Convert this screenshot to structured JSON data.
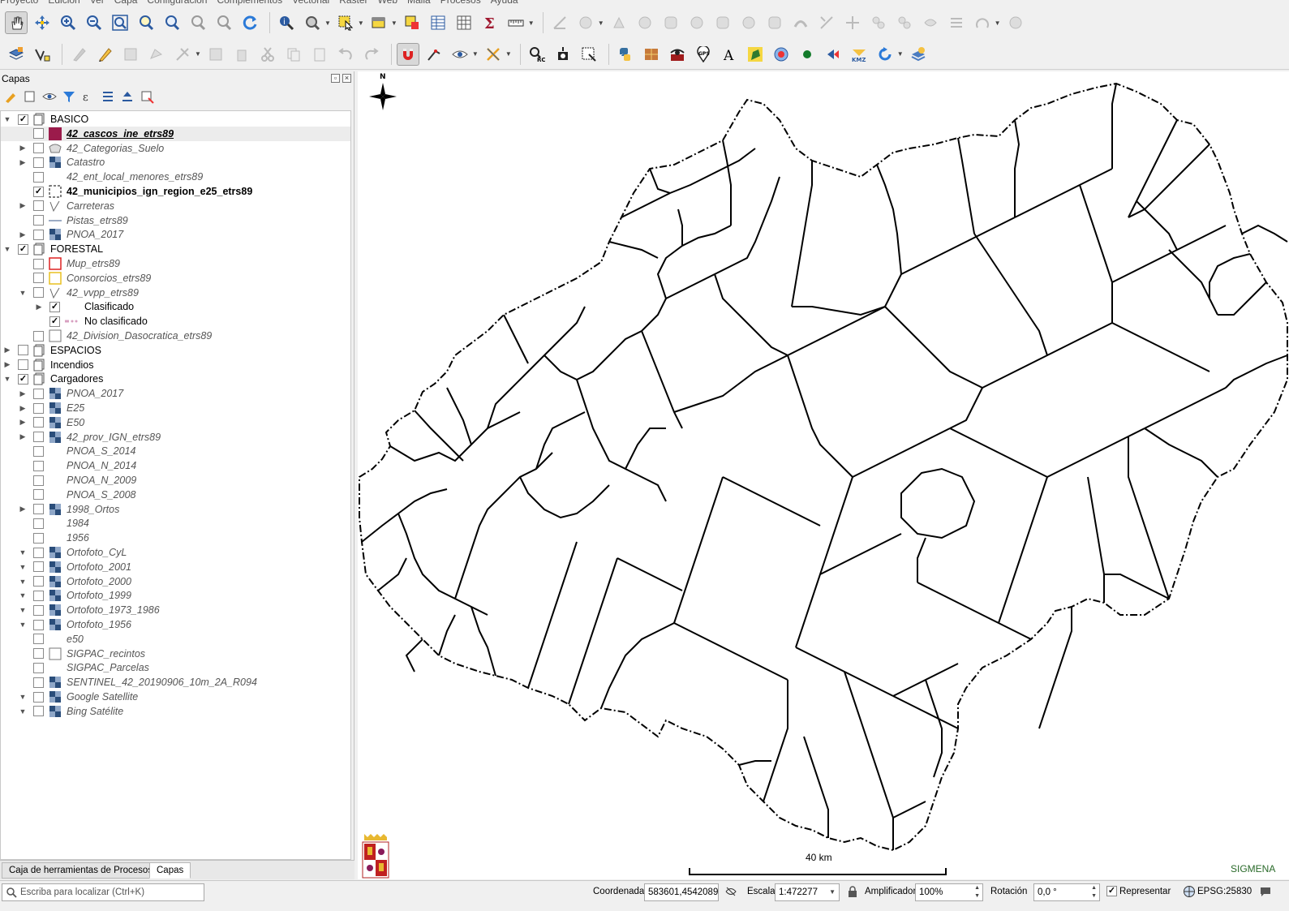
{
  "menu": [
    "Proyecto",
    "Edición",
    "Ver",
    "Capa",
    "Configuración",
    "Complementos",
    "Vectorial",
    "Ráster",
    "Web",
    "Malla",
    "Procesos",
    "Ayuda"
  ],
  "layers_panel": {
    "title": "Capas",
    "items": [
      {
        "name": "BASICO",
        "level": 0,
        "expander": "open",
        "checked": true,
        "icon": "group-icon",
        "style": "normal"
      },
      {
        "name": "42_cascos_ine_etrs89",
        "level": 1,
        "expander": "",
        "checked": false,
        "icon": "fill-swatch-icon",
        "swatch": "#9b1b4b",
        "style": "italic-bold-underline",
        "selected": true
      },
      {
        "name": "42_Categorias_Suelo",
        "level": 1,
        "expander": "closed",
        "checked": false,
        "icon": "polygon-layer-icon",
        "style": "italic"
      },
      {
        "name": "Catastro",
        "level": 1,
        "expander": "closed",
        "checked": false,
        "icon": "raster-icon",
        "style": "italic"
      },
      {
        "name": "42_ent_local_menores_etrs89",
        "level": 1,
        "expander": "",
        "checked": false,
        "icon": "",
        "style": "italic"
      },
      {
        "name": "42_municipios_ign_region_e25_etrs89",
        "level": 1,
        "expander": "",
        "checked": true,
        "icon": "dashed-outline-icon",
        "style": "bold"
      },
      {
        "name": "Carreteras",
        "level": 1,
        "expander": "closed",
        "checked": false,
        "icon": "line-rules-icon",
        "style": "italic"
      },
      {
        "name": "Pistas_etrs89",
        "level": 1,
        "expander": "",
        "checked": false,
        "icon": "line-swatch-icon",
        "style": "italic"
      },
      {
        "name": "PNOA_2017",
        "level": 1,
        "expander": "closed",
        "checked": false,
        "icon": "raster-icon",
        "style": "italic"
      },
      {
        "name": "FORESTAL",
        "level": 0,
        "expander": "open",
        "checked": true,
        "icon": "group-icon",
        "style": "normal"
      },
      {
        "name": "Mup_etrs89",
        "level": 1,
        "expander": "",
        "checked": false,
        "icon": "red-outline-icon",
        "style": "italic"
      },
      {
        "name": "Consorcios_etrs89",
        "level": 1,
        "expander": "",
        "checked": false,
        "icon": "yellow-outline-icon",
        "style": "italic"
      },
      {
        "name": "42_vvpp_etrs89",
        "level": 1,
        "expander": "open",
        "checked": false,
        "icon": "line-rules-icon",
        "style": "italic"
      },
      {
        "name": "Clasificado",
        "level": 2,
        "expander": "closed",
        "checked": true,
        "icon": "",
        "style": "normal"
      },
      {
        "name": "No clasificado",
        "level": 2,
        "expander": "",
        "checked": true,
        "icon": "pink-dash-icon",
        "style": "normal"
      },
      {
        "name": "42_Division_Dasocratica_etrs89",
        "level": 1,
        "expander": "",
        "checked": false,
        "icon": "gray-outline-icon",
        "style": "italic"
      },
      {
        "name": "ESPACIOS",
        "level": 0,
        "expander": "closed",
        "checked": false,
        "icon": "group-icon",
        "style": "normal"
      },
      {
        "name": "Incendios",
        "level": 0,
        "expander": "closed",
        "checked": false,
        "icon": "group-icon",
        "style": "normal"
      },
      {
        "name": "Cargadores",
        "level": 0,
        "expander": "open",
        "checked": true,
        "icon": "group-icon",
        "style": "normal"
      },
      {
        "name": "PNOA_2017",
        "level": 1,
        "expander": "closed",
        "checked": false,
        "icon": "raster-icon",
        "style": "italic"
      },
      {
        "name": "E25",
        "level": 1,
        "expander": "closed",
        "checked": false,
        "icon": "raster-icon",
        "style": "italic"
      },
      {
        "name": "E50",
        "level": 1,
        "expander": "closed",
        "checked": false,
        "icon": "raster-icon",
        "style": "italic"
      },
      {
        "name": "42_prov_IGN_etrs89",
        "level": 1,
        "expander": "closed",
        "checked": false,
        "icon": "raster-icon",
        "style": "italic"
      },
      {
        "name": "PNOA_S_2014",
        "level": 1,
        "expander": "",
        "checked": false,
        "icon": "",
        "style": "italic"
      },
      {
        "name": "PNOA_N_2014",
        "level": 1,
        "expander": "",
        "checked": false,
        "icon": "",
        "style": "italic"
      },
      {
        "name": "PNOA_N_2009",
        "level": 1,
        "expander": "",
        "checked": false,
        "icon": "",
        "style": "italic"
      },
      {
        "name": "PNOA_S_2008",
        "level": 1,
        "expander": "",
        "checked": false,
        "icon": "",
        "style": "italic"
      },
      {
        "name": "1998_Ortos",
        "level": 1,
        "expander": "closed",
        "checked": false,
        "icon": "raster-icon",
        "style": "italic"
      },
      {
        "name": "1984",
        "level": 1,
        "expander": "",
        "checked": false,
        "icon": "",
        "style": "italic"
      },
      {
        "name": "1956",
        "level": 1,
        "expander": "",
        "checked": false,
        "icon": "",
        "style": "italic"
      },
      {
        "name": "Ortofoto_CyL",
        "level": 1,
        "expander": "open",
        "checked": false,
        "icon": "raster-icon",
        "style": "italic"
      },
      {
        "name": "Ortofoto_2001",
        "level": 1,
        "expander": "open",
        "checked": false,
        "icon": "raster-icon",
        "style": "italic"
      },
      {
        "name": "Ortofoto_2000",
        "level": 1,
        "expander": "open",
        "checked": false,
        "icon": "raster-icon",
        "style": "italic"
      },
      {
        "name": "Ortofoto_1999",
        "level": 1,
        "expander": "open",
        "checked": false,
        "icon": "raster-icon",
        "style": "italic"
      },
      {
        "name": "Ortofoto_1973_1986",
        "level": 1,
        "expander": "open",
        "checked": false,
        "icon": "raster-icon",
        "style": "italic"
      },
      {
        "name": "Ortofoto_1956",
        "level": 1,
        "expander": "open",
        "checked": false,
        "icon": "raster-icon",
        "style": "italic"
      },
      {
        "name": "e50",
        "level": 1,
        "expander": "",
        "checked": false,
        "icon": "",
        "style": "italic"
      },
      {
        "name": "SIGPAC_recintos",
        "level": 1,
        "expander": "",
        "checked": false,
        "icon": "gray-outline-icon",
        "style": "italic"
      },
      {
        "name": "SIGPAC_Parcelas",
        "level": 1,
        "expander": "",
        "checked": false,
        "icon": "",
        "style": "italic"
      },
      {
        "name": "SENTINEL_42_20190906_10m_2A_R094",
        "level": 1,
        "expander": "",
        "checked": false,
        "icon": "raster-icon",
        "style": "italic"
      },
      {
        "name": "Google Satellite",
        "level": 1,
        "expander": "open",
        "checked": false,
        "icon": "raster-icon",
        "style": "italic"
      },
      {
        "name": "Bing Satélite",
        "level": 1,
        "expander": "open",
        "checked": false,
        "icon": "raster-icon",
        "style": "italic"
      }
    ]
  },
  "bottom_tabs": [
    {
      "label": "Caja de herramientas de Procesos",
      "active": false
    },
    {
      "label": "Capas",
      "active": true
    }
  ],
  "map": {
    "north_label": "N",
    "scale_label": "40 km",
    "credit": "SIGMENA"
  },
  "status": {
    "locator_placeholder": "Escriba para localizar (Ctrl+K)",
    "coord_label": "Coordenada",
    "coord_value": "583601,4542089",
    "scale_label": "Escala",
    "scale_value": "1:472277",
    "magnifier_label": "Amplificador",
    "magnifier_value": "100%",
    "rotation_label": "Rotación",
    "rotation_value": "0,0 °",
    "render_label": "Representar",
    "render_checked": true,
    "crs": "EPSG:25830"
  },
  "colors": {
    "accent": "#9b1b4b",
    "raster": "#2a4d7a"
  }
}
